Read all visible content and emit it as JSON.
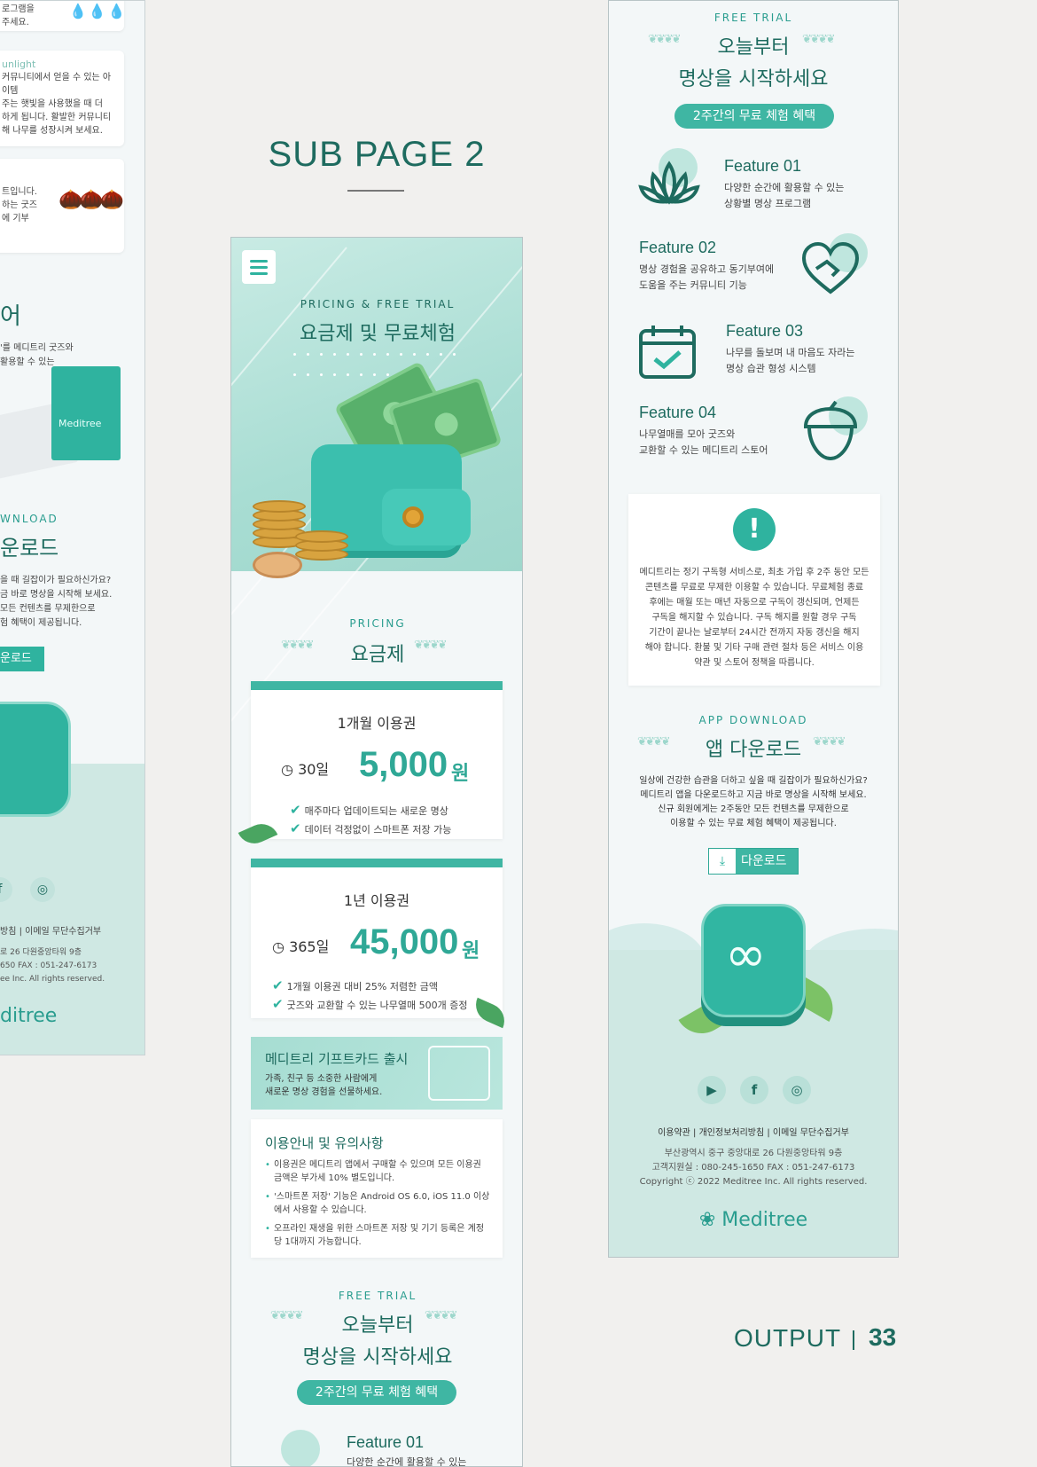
{
  "headings": {
    "sub_page": "SUB PAGE 2",
    "output": "OUTPUT",
    "page_number": "33"
  },
  "colors": {
    "primary": "#2fb39f",
    "dark": "#1e6b5f",
    "light": "#cfe8e3"
  },
  "left_panel": {
    "top_text": [
      "로그램을",
      "주세요."
    ],
    "sunlight_title": "unlight",
    "sunlight_text": [
      "커뮤니티에서 얻을 수 있는 아이템",
      "주는 햇빛을 사용했을 때 더",
      "하게 됩니다. 활발한 커뮤니티",
      "해 나무를 성장시켜 보세요."
    ],
    "acorn_text": [
      "트입니다.",
      "하는 굿즈",
      "에 기부"
    ],
    "store_heading": "어",
    "store_desc": [
      "'를 메디트리 굿즈와",
      "활용할 수 있는"
    ],
    "bag_logo": "Meditree",
    "download_small": "WNLOAD",
    "download_heading": "운로드",
    "download_desc": [
      "을 때 길잡이가 필요하신가요?",
      "금 바로 명상을 시작해 보세요.",
      "모든 컨텐츠를 무제한으로",
      "험 혜택이 제공됩니다."
    ],
    "download_button": "운로드",
    "footer_links": "방침 | 이메일 무단수집거부",
    "footer_info": [
      "로 26 다원중앙타워 9층",
      "650 FAX : 051-247-6173",
      "ee Inc. All rights reserved."
    ],
    "footer_logo": "ditree"
  },
  "mid": {
    "hero_small": "PRICING & FREE TRIAL",
    "hero_title": "요금제 및 무료체험",
    "pricing_small": "PRICING",
    "pricing_title": "요금제",
    "plans": [
      {
        "name": "1개월 이용권",
        "duration": "30일",
        "price": "5,000",
        "unit": "원",
        "features": [
          "매주마다 업데이트되는 새로운 명상",
          "데이터 걱정없이 스마트폰 저장 가능"
        ]
      },
      {
        "name": "1년 이용권",
        "duration": "365일",
        "price": "45,000",
        "unit": "원",
        "features": [
          "1개월 이용권 대비 25% 저렴한 금액",
          "굿즈와 교환할 수 있는 나무열매 500개 증정"
        ]
      }
    ],
    "gift_title": "메디트리 기프트카드 출시",
    "gift_desc": [
      "가족, 친구 등 소중한 사람에게",
      "새로운 명상 경험을 선물하세요."
    ],
    "notice_title": "이용안내 및 유의사항",
    "notice_items": [
      "이용권은 메디트리 앱에서 구매할 수 있으며 모든 이용권 금액은 부가세 10% 별도입니다.",
      "'스마트폰 저장' 기능은 Android OS 6.0, iOS 11.0 이상에서 사용할 수 있습니다.",
      "오프라인 재생을 위한 스마트폰 저장 및 기기 등록은 계정 당 1대까지 가능합니다."
    ],
    "trial_small": "FREE TRIAL",
    "trial_title_1": "오늘부터",
    "trial_title_2": "명상을 시작하세요",
    "trial_pill": "2주간의 무료 체험 혜택",
    "feature_preview_title": "Feature 01",
    "feature_preview_desc": "다양한 순간에 활용할 수 있는"
  },
  "right": {
    "trial_small": "FREE TRIAL",
    "trial_title_1": "오늘부터",
    "trial_title_2": "명상을 시작하세요",
    "trial_pill": "2주간의 무료 체험 혜택",
    "features": [
      {
        "title": "Feature 01",
        "desc_1": "다양한 순간에 활용할 수 있는",
        "desc_2": "상황별 명상 프로그램",
        "icon": "lotus-icon"
      },
      {
        "title": "Feature 02",
        "desc_1": "명상 경험을 공유하고 동기부여에",
        "desc_2": "도움을 주는 커뮤니티 기능",
        "icon": "heart-hands-icon"
      },
      {
        "title": "Feature 03",
        "desc_1": "나무를 돌보며 내 마음도 자라는",
        "desc_2": "명상 습관 형성 시스템",
        "icon": "calendar-check-icon"
      },
      {
        "title": "Feature 04",
        "desc_1": "나무열매를 모아 굿즈와",
        "desc_2": "교환할 수 있는 메디트리 스토어",
        "icon": "acorn-icon"
      }
    ],
    "info_text": [
      "메디트리는 정기 구독형 서비스로, 최초 가입 후 2주 동안 모든",
      "콘텐츠를 무료로 무제한 이용할 수 있습니다. 무료체험 종료",
      "후에는 매월 또는 매년 자동으로 구독이 갱신되며, 언제든",
      "구독을 해지할 수 있습니다. 구독 해지를 원할 경우 구독",
      "기간이 끝나는 날로부터 24시간 전까지 자동 갱신을 해지",
      "해야 합니다. 환불 및 기타 구매 관련 절차 등은 서비스 이용",
      "약관 및 스토어 정책을 따릅니다."
    ],
    "dl_small": "APP DOWNLOAD",
    "dl_title": "앱 다운로드",
    "dl_desc": [
      "일상에 건강한 습관을 더하고 싶을 때 길잡이가 필요하신가요?",
      "메디트리 앱을 다운로드하고 지금 바로 명상을 시작해 보세요.",
      "신규 회원에게는 2주동안 모든 컨텐츠를 무제한으로",
      "이용할 수 있는 무료 체험 혜택이 제공됩니다."
    ],
    "dl_button": "다운로드",
    "footer_links": "이용약관 | 개인정보처리방침 | 이메일 무단수집거부",
    "footer_info": [
      "부산광역시 중구 중앙대로 26 다원중앙타워 9층",
      "고객지원실 : 080-245-1650 FAX : 051-247-6173",
      "Copyright ⓒ 2022 Meditree Inc. All rights reserved."
    ],
    "footer_logo": "Meditree"
  }
}
